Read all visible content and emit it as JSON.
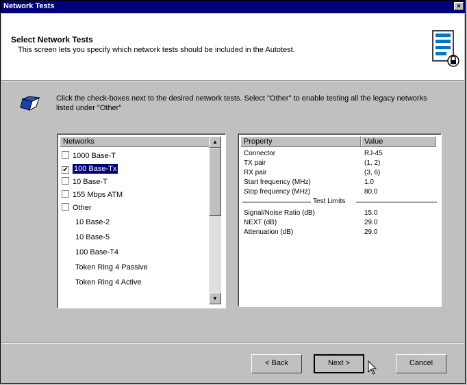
{
  "window": {
    "title": "Network Tests",
    "close_glyph": "×"
  },
  "header": {
    "title": "Select Network Tests",
    "description": "This screen lets you specify which network tests should be included in the Autotest.",
    "icon": "checklist-lock-icon"
  },
  "instructions": {
    "icon": "book-icon",
    "text": "Click the check-boxes next to the desired network tests.  Select \"Other\" to enable testing all the legacy networks listed under \"Other\""
  },
  "networks": {
    "header": "Networks",
    "items": [
      {
        "label": "1000 Base-T",
        "checkbox": true,
        "checked": false,
        "selected": false
      },
      {
        "label": "100 Base-Tx",
        "checkbox": true,
        "checked": true,
        "selected": true
      },
      {
        "label": "10 Base-T",
        "checkbox": true,
        "checked": false,
        "selected": false
      },
      {
        "label": "155 Mbps ATM",
        "checkbox": true,
        "checked": false,
        "selected": false
      },
      {
        "label": "Other",
        "checkbox": true,
        "checked": false,
        "selected": false
      },
      {
        "label": "10 Base-2",
        "checkbox": false
      },
      {
        "label": "10 Base-5",
        "checkbox": false
      },
      {
        "label": "100 Base-T4",
        "checkbox": false
      },
      {
        "label": "Token Ring 4 Passive",
        "checkbox": false
      },
      {
        "label": "Token Ring 4 Active",
        "checkbox": false
      }
    ]
  },
  "properties": {
    "col_property": "Property",
    "col_value": "Value",
    "rows": [
      {
        "name": "Connector",
        "value": "RJ-45"
      },
      {
        "name": "TX pair",
        "value": "(1, 2)"
      },
      {
        "name": "RX pair",
        "value": "(3, 6)"
      },
      {
        "name": "Start frequency (MHz)",
        "value": "1.0"
      },
      {
        "name": "Stop frequency (MHz)",
        "value": "80.0"
      }
    ],
    "limits_label": "Test Limits",
    "limit_rows": [
      {
        "name": "Signal/Noise Ratio (dB)",
        "value": "15.0"
      },
      {
        "name": "NEXT (dB)",
        "value": "29.0"
      },
      {
        "name": "Attenuation (dB)",
        "value": "29.0"
      }
    ]
  },
  "buttons": {
    "back": "< Back",
    "next": "Next >",
    "cancel": "Cancel"
  },
  "colors": {
    "title_bar": "#00007b",
    "face": "#c0c0c0",
    "selection": "#00007b"
  }
}
